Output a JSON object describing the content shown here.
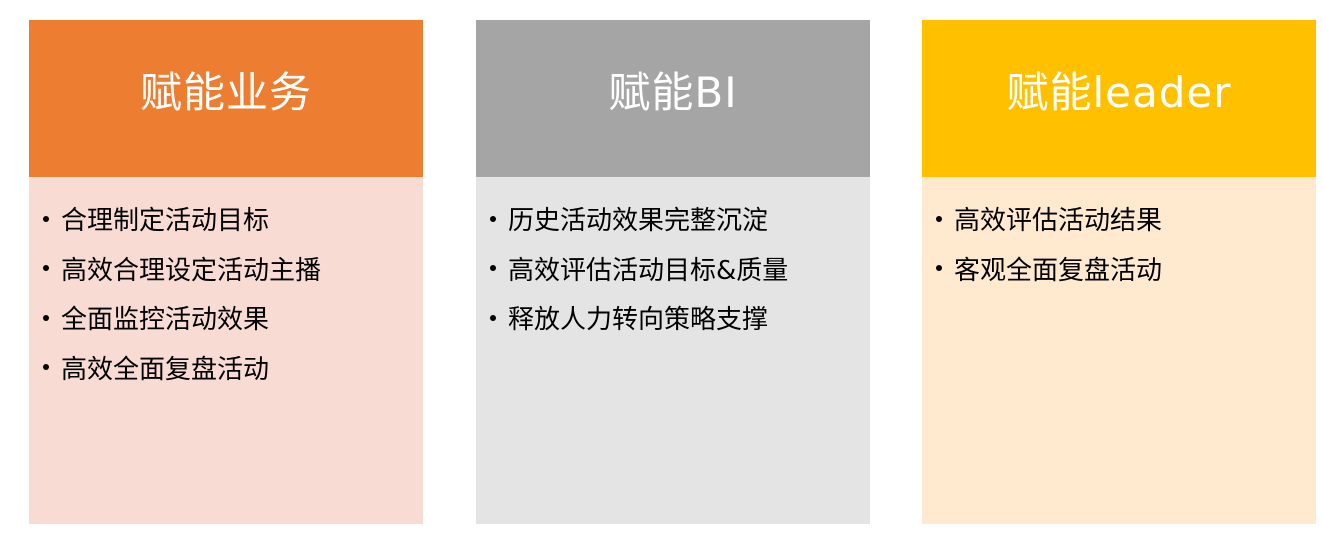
{
  "cards": [
    {
      "title": "赋能业务",
      "header_color": "#ED7D31",
      "body_color": "#F8DCD4",
      "items": [
        "合理制定活动目标",
        "高效合理设定活动主播",
        "全面监控活动效果",
        "高效全面复盘活动"
      ]
    },
    {
      "title": "赋能BI",
      "header_color": "#A5A5A5",
      "body_color": "#E4E4E4",
      "items": [
        "历史活动效果完整沉淀",
        "高效评估活动目标&质量",
        "释放人力转向策略支撑"
      ]
    },
    {
      "title": "赋能leader",
      "header_color": "#FFC000",
      "body_color": "#FFEAD0",
      "items": [
        "高效评估活动结果",
        "客观全面复盘活动"
      ]
    }
  ]
}
